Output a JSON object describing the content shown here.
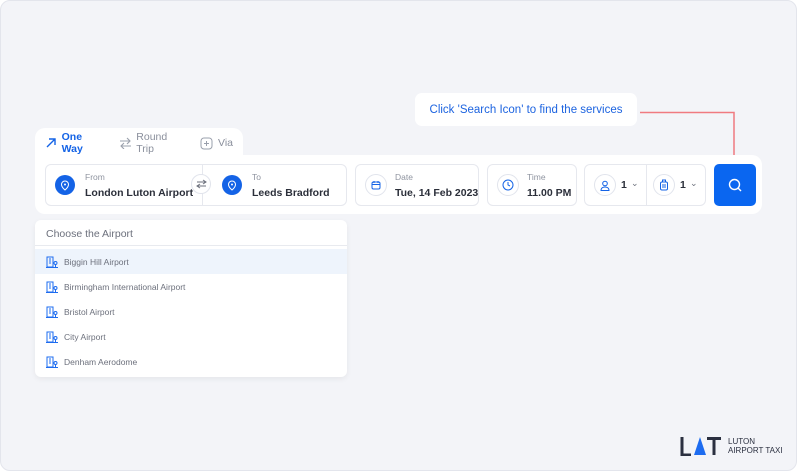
{
  "tooltip": {
    "text": "Click 'Search Icon' to find the services"
  },
  "tabs": [
    {
      "label": "One Way",
      "icon": "arrow-up-right-icon",
      "active": true
    },
    {
      "label": "Round Trip",
      "icon": "swap-arrows-icon"
    },
    {
      "label": "Via",
      "icon": "plus-square-icon"
    }
  ],
  "from": {
    "label": "From",
    "value": "London Luton Airport"
  },
  "to": {
    "label": "To",
    "value": "Leeds Bradford"
  },
  "date": {
    "label": "Date",
    "value": "Tue, 14 Feb 2023"
  },
  "time": {
    "label": "Time",
    "value": "11.00 PM"
  },
  "passengers": {
    "value": "1"
  },
  "luggage": {
    "value": "1"
  },
  "dropdown": {
    "header": "Choose the Airport",
    "items": [
      "Biggin Hill Airport",
      "Birmingham International Airport",
      "Bristol Airport",
      "City Airport",
      "Denham Aerodome"
    ]
  },
  "logo": {
    "mark": "LAT",
    "line1": "LUTON",
    "line2": "AIRPORT TAXI"
  },
  "colors": {
    "accent": "#0a66f0",
    "connector": "#f07a80",
    "background": "#f3f4f8"
  }
}
